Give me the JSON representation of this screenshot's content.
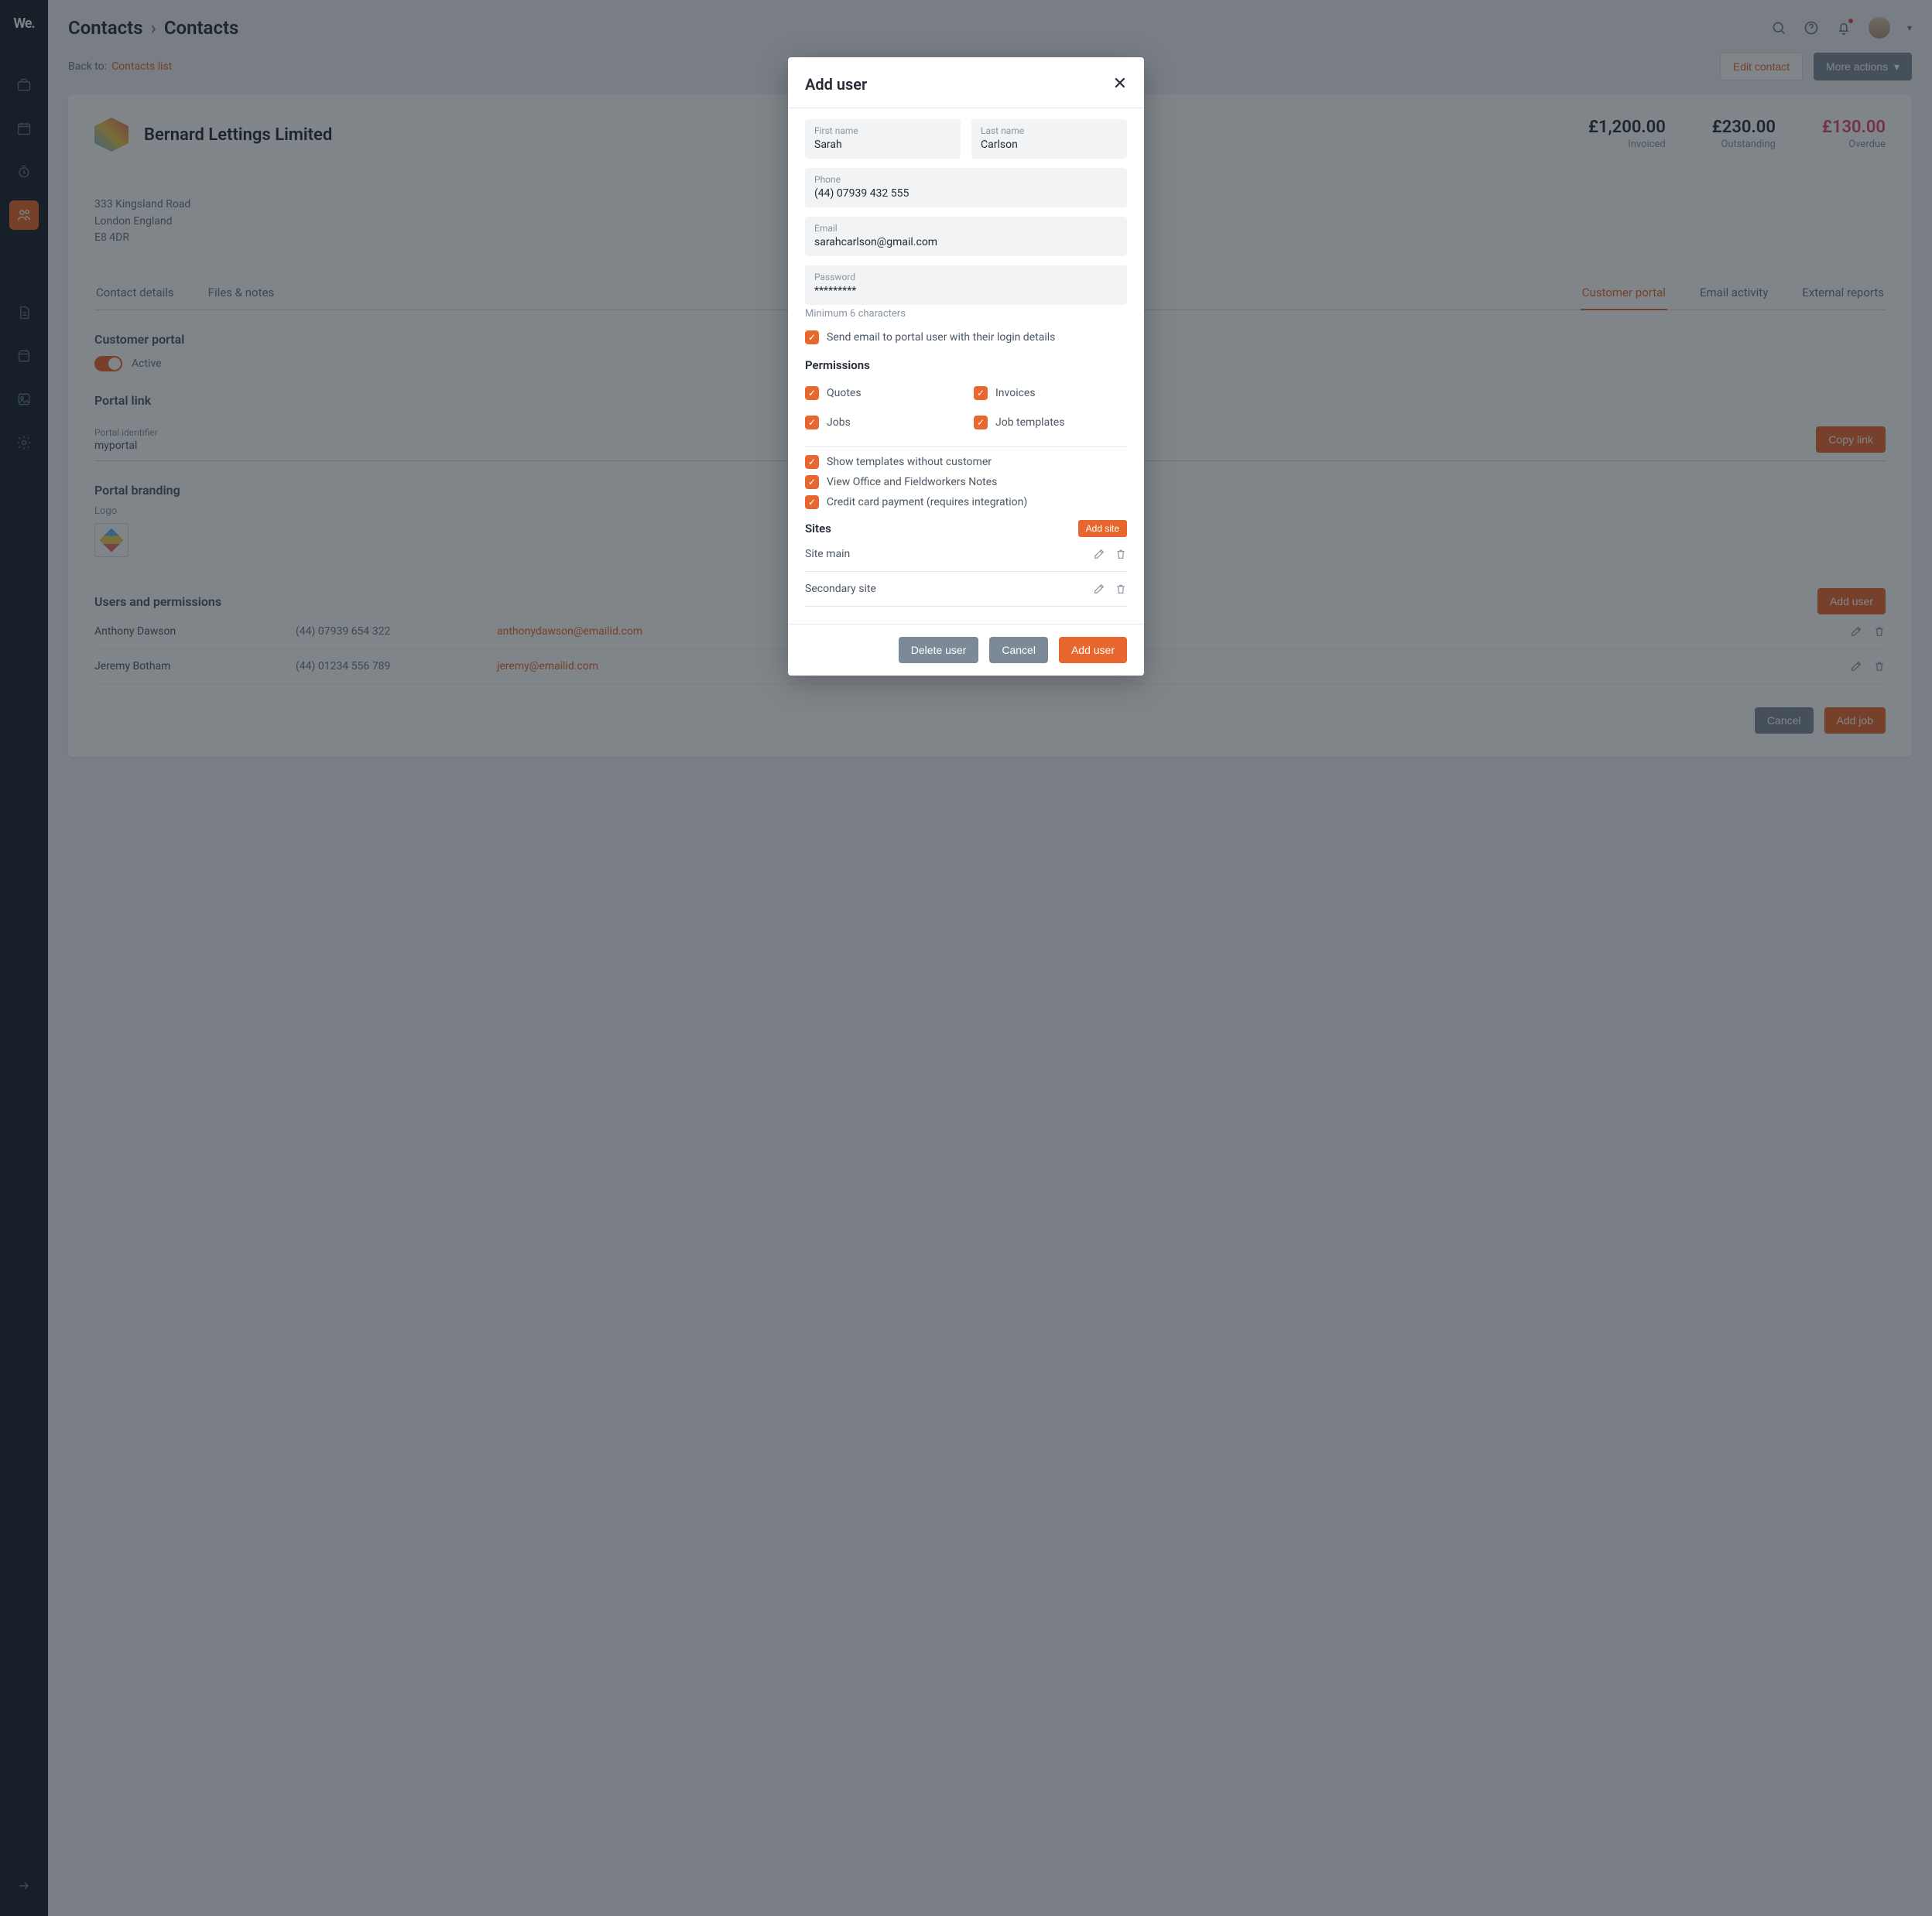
{
  "logo": "We.",
  "breadcrumb": {
    "a": "Contacts",
    "b": "Contacts"
  },
  "back": {
    "label": "Back to:",
    "link": "Contacts list"
  },
  "header_actions": {
    "edit": "Edit contact",
    "more": "More actions"
  },
  "company": {
    "name": "Bernard Lettings Limited",
    "addr1": "333 Kingsland Road",
    "addr2": "London England",
    "addr3": "E8 4DR"
  },
  "kpis": {
    "invoiced": {
      "amt": "£1,200.00",
      "lbl": "Invoiced"
    },
    "outstanding": {
      "amt": "£230.00",
      "lbl": "Outstanding"
    },
    "overdue": {
      "amt": "£130.00",
      "lbl": "Overdue"
    }
  },
  "tabs": {
    "t0": "Contact details",
    "t1": "Files & notes",
    "t5": "Customer portal",
    "t6": "Email activity",
    "t7": "External reports"
  },
  "portal": {
    "section_title": "Customer portal",
    "toggle_label": "Active",
    "link_title": "Portal link",
    "identifier_label": "Portal identifier",
    "identifier_value": "myportal",
    "copy": "Copy link",
    "branding_title": "Portal branding",
    "logo_label": "Logo"
  },
  "users_section": {
    "title": "Users and permissions",
    "add": "Add user",
    "rows": [
      {
        "name": "Anthony Dawson",
        "phone": "(44) 07939 654 322",
        "email": "anthonydawson@emailid.com"
      },
      {
        "name": "Jeremy Botham",
        "phone": "(44) 01234 556 789",
        "email": "jeremy@emailid.com"
      }
    ]
  },
  "footer": {
    "cancel": "Cancel",
    "addjob": "Add job"
  },
  "modal": {
    "title": "Add user",
    "fields": {
      "first_label": "First name",
      "first_value": "Sarah",
      "last_label": "Last name",
      "last_value": "Carlson",
      "phone_label": "Phone",
      "phone_value": "(44) 07939 432 555",
      "email_label": "Email",
      "email_value": "sarahcarlson@gmail.com",
      "password_label": "Password",
      "password_value": "*********"
    },
    "hint": "Minimum 6 characters",
    "send_cb": "Send email to portal user with their login details",
    "perm_title": "Permissions",
    "perms": {
      "quotes": "Quotes",
      "invoices": "Invoices",
      "jobs": "Jobs",
      "templates": "Job templates"
    },
    "perm_extra": {
      "a": "Show templates without customer",
      "b": "View Office and Fieldworkers Notes",
      "c": "Credit card payment (requires integration)"
    },
    "sites_title": "Sites",
    "add_site": "Add site",
    "site1": "Site main",
    "site2": "Secondary site",
    "buttons": {
      "delete": "Delete user",
      "cancel": "Cancel",
      "add": "Add user"
    }
  }
}
